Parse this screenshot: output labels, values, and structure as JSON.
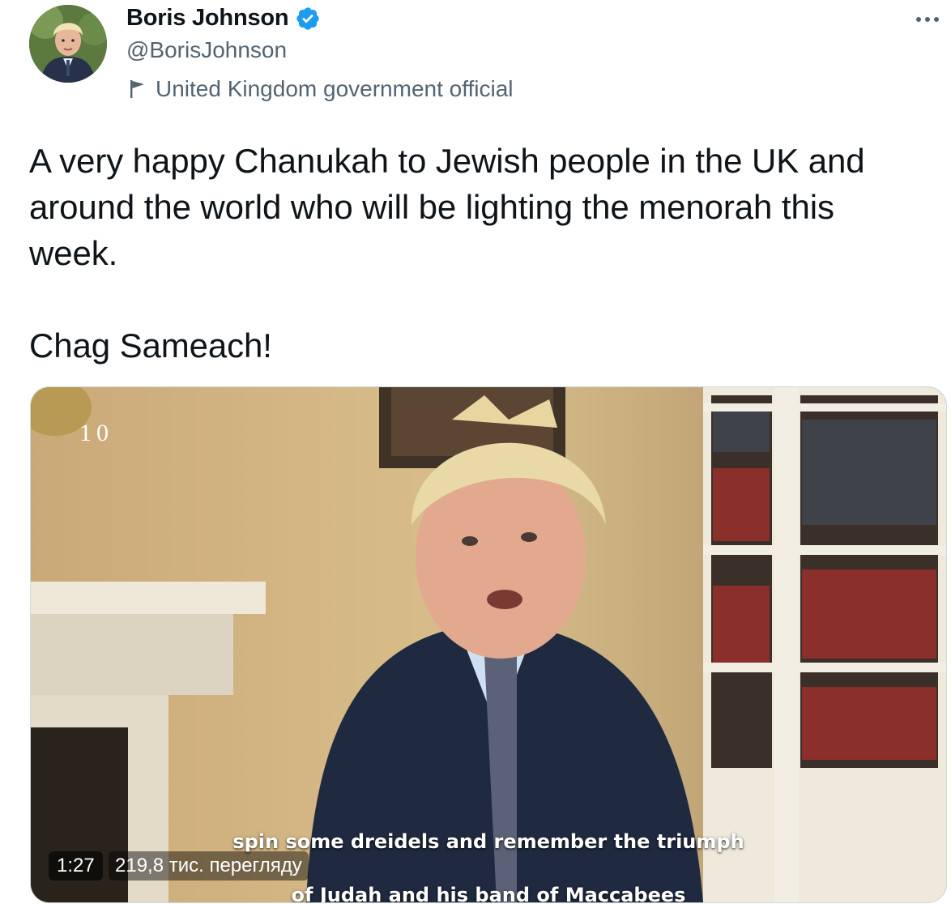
{
  "author": {
    "name": "Boris Johnson",
    "handle": "@BorisJohnson",
    "verified": true,
    "label": "United Kingdom government official",
    "avatar_icon": "profile-photo",
    "label_icon": "flag-icon"
  },
  "menu": {
    "icon": "more-options-icon"
  },
  "tweet": {
    "text_line1": "A very happy Chanukah to Jewish people in the UK and",
    "text_line2": "around the world who will be lighting the menorah this",
    "text_line3": "week.",
    "text_line4": "Chag Sameach!"
  },
  "video": {
    "logo": "10",
    "subtitle_line1": "spin some dreidels and remember the triumph",
    "subtitle_line2": "of Judah and his band of Maccabees",
    "duration": "1:27",
    "views": "219,8 тис. перегляду"
  },
  "colors": {
    "verified_badge": "#1d9bf0",
    "text_primary": "#0f1419",
    "text_secondary": "#536471"
  }
}
